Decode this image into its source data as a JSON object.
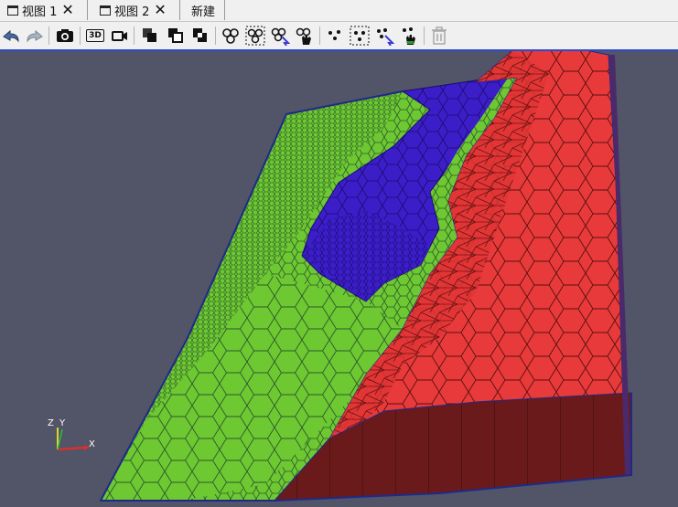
{
  "tabs": [
    {
      "label": "视图 1",
      "close": "✕"
    },
    {
      "label": "视图 2",
      "close": "✕"
    },
    {
      "label": "新建"
    }
  ],
  "toolbar": {
    "icons": [
      "reset-camera-back-icon",
      "reset-camera-forward-icon",
      "screenshot-camera-icon",
      "3d-toggle-icon",
      "record-camera-icon",
      "layer-front-icon",
      "layer-back-icon",
      "layer-split-icon",
      "select-cells-icon",
      "select-cells-frustum-icon",
      "select-cells-interactive-icon",
      "select-cells-hand-icon",
      "select-points-icon",
      "select-points-frustum-icon",
      "select-points-interactive-icon",
      "select-points-hand-icon",
      "clear-selection-trash-icon"
    ],
    "label_3d": "3D"
  },
  "viewport": {
    "background": "#525467",
    "mesh_colors": {
      "green": "#6ec832",
      "blue": "#3c1ec8",
      "red": "#e83a3a",
      "dark_red": "#6a1a1a"
    }
  },
  "axes": {
    "x": "X",
    "y": "Y",
    "z": "Z"
  }
}
